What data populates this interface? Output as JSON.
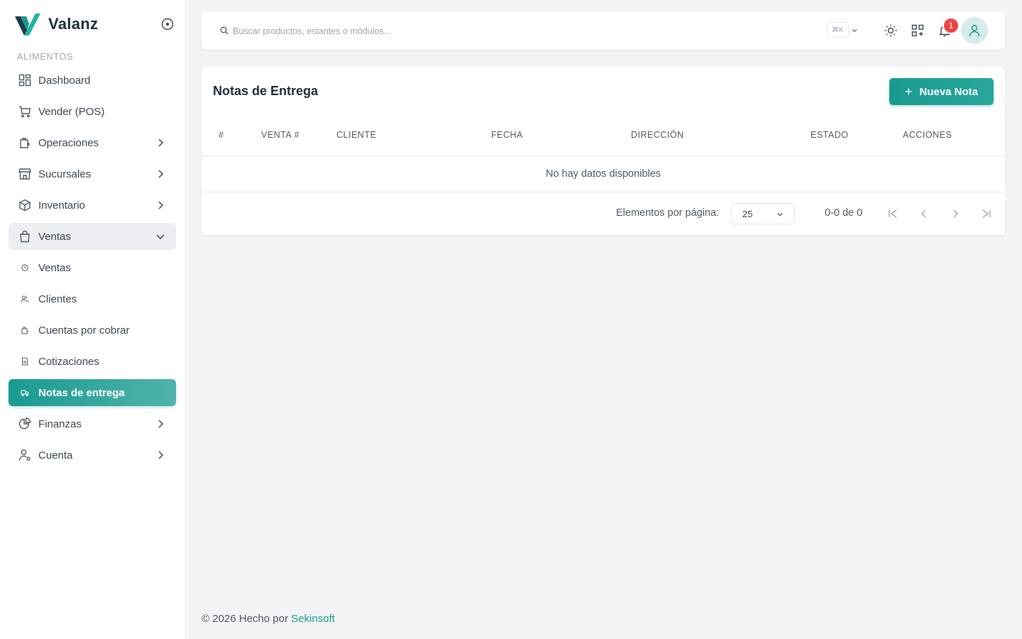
{
  "brand": {
    "name": "Valanz"
  },
  "sidebar": {
    "section_label": "ALIMENTOS",
    "items": [
      {
        "label": "Dashboard",
        "icon": "dashboard-icon",
        "chevron": false
      },
      {
        "label": "Vender (POS)",
        "icon": "cart-icon",
        "chevron": false
      },
      {
        "label": "Operaciones",
        "icon": "operations-icon",
        "chevron": "right"
      },
      {
        "label": "Sucursales",
        "icon": "store-icon",
        "chevron": "right"
      },
      {
        "label": "Inventario",
        "icon": "box-icon",
        "chevron": "right"
      },
      {
        "label": "Ventas",
        "icon": "shopping-bag-icon",
        "chevron": "down",
        "state": "open"
      },
      {
        "label": "Ventas",
        "icon": "history-icon",
        "sub": true
      },
      {
        "label": "Clientes",
        "icon": "users-icon",
        "sub": true
      },
      {
        "label": "Cuentas por cobrar",
        "icon": "receivable-icon",
        "sub": true
      },
      {
        "label": "Cotizaciones",
        "icon": "quote-icon",
        "sub": true
      },
      {
        "label": "Notas de entrega",
        "icon": "delivery-note-icon",
        "sub": true,
        "state": "active"
      },
      {
        "label": "Finanzas",
        "icon": "chart-pie-icon",
        "chevron": "right"
      },
      {
        "label": "Cuenta",
        "icon": "user-settings-icon",
        "chevron": "right"
      }
    ]
  },
  "topbar": {
    "search_placeholder": "Buscar productos, estantes o módulos...",
    "shortcut": "⌘K",
    "notifications_count": "1"
  },
  "page": {
    "title": "Notas de Entrega",
    "new_button": "Nueva Nota",
    "columns": [
      "#",
      "VENTA #",
      "CLIENTE",
      "FECHA",
      "DIRECCIÓN",
      "ESTADO",
      "ACCIONES"
    ],
    "empty_text": "No hay datos disponibles",
    "pager": {
      "label": "Elementos por página:",
      "page_size": "25",
      "range": "0-0 de 0"
    }
  },
  "footer": {
    "text": "© 2026 Hecho por",
    "link": "Sekinsoft"
  },
  "colors": {
    "accent": "#1a9a90",
    "badge": "#ef4444"
  }
}
